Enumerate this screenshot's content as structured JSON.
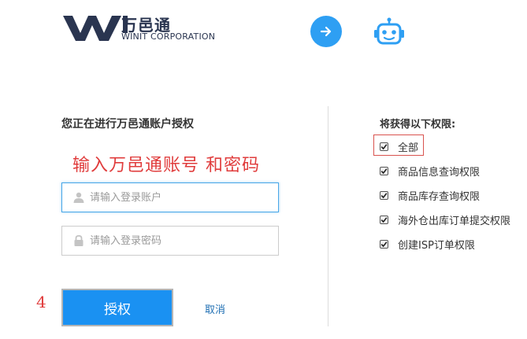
{
  "header": {
    "logo_cn": "万邑通",
    "logo_en": "WINIT CORPORATION",
    "accent_color": "#2e9ff3"
  },
  "login": {
    "title": "您正在进行万邑通账户授权",
    "annotation": "输入万邑通账号  和密码",
    "account": {
      "placeholder": "请输入登录账户",
      "value": ""
    },
    "password": {
      "placeholder": "请输入登录密码",
      "value": ""
    },
    "step_number": "4",
    "authorize_label": "授权",
    "cancel_label": "取消"
  },
  "permissions": {
    "title": "将获得以下权限:",
    "items": [
      {
        "label": "全部",
        "checked": true
      },
      {
        "label": "商品信息查询权限",
        "checked": true
      },
      {
        "label": "商品库存查询权限",
        "checked": true
      },
      {
        "label": "海外仓出库订单提交权限",
        "checked": true
      },
      {
        "label": "创建ISP订单权限",
        "checked": true
      }
    ]
  }
}
